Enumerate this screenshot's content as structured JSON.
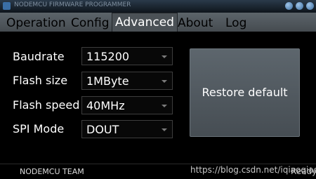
{
  "window": {
    "title": "NODEMCU FIRMWARE PROGRAMMER"
  },
  "tabs": [
    {
      "label": "Operation"
    },
    {
      "label": "Config"
    },
    {
      "label": "Advanced"
    },
    {
      "label": "About"
    },
    {
      "label": "Log"
    }
  ],
  "active_tab": "Advanced",
  "settings": {
    "baudrate": {
      "label": "Baudrate",
      "value": "115200"
    },
    "flash_size": {
      "label": "Flash size",
      "value": "1MByte"
    },
    "flash_speed": {
      "label": "Flash speed",
      "value": "40MHz"
    },
    "spi_mode": {
      "label": "SPI Mode",
      "value": "DOUT"
    }
  },
  "buttons": {
    "restore_default": "Restore default"
  },
  "status": {
    "left": "NODEMCU TEAM",
    "right": "Ready",
    "watermark": "https://blog.csdn.net/iqiaoqiao"
  },
  "colors": {
    "background": "#000000",
    "tab_bar": "#4f565b",
    "button": "#555d63"
  },
  "icons": [
    "app-icon",
    "minimize-icon",
    "maximize-icon",
    "close-icon",
    "chevron-down-icon"
  ]
}
